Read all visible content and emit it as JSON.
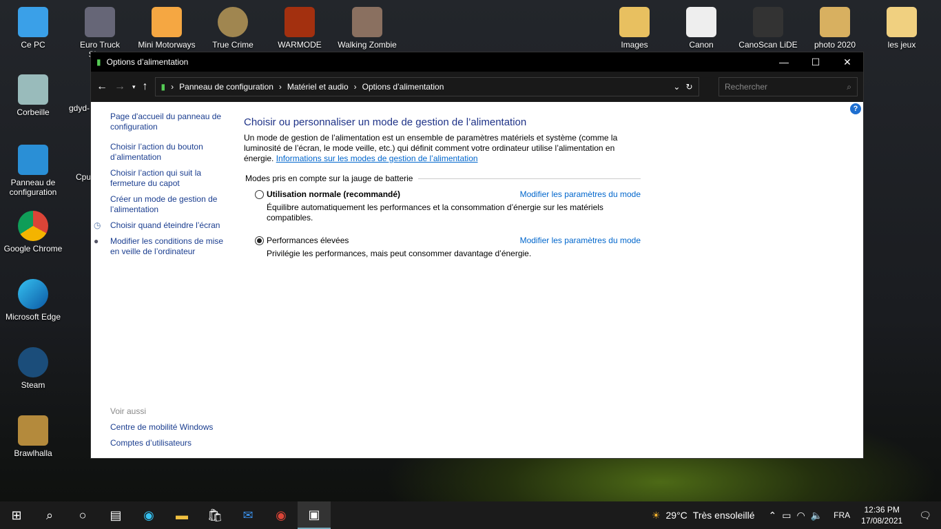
{
  "desktop": {
    "icons_top": [
      "Euro Truck Sim…",
      "Mini Motorways",
      "True Crime",
      "WARMODE",
      "Walking Zombie",
      "Images",
      "Canon",
      "CanoScan LiDE",
      "photo 2020",
      "les jeux"
    ],
    "icons_left": [
      "Ce PC",
      "Corbeille",
      "Panneau de configuration",
      "Google Chrome",
      "Microsoft Edge",
      "Steam",
      "Brawlhalla"
    ],
    "partial": [
      "gdyd-",
      "Cpu"
    ]
  },
  "window": {
    "title": "Options d’alimentation",
    "breadcrumb": [
      "Panneau de configuration",
      "Matériel et audio",
      "Options d’alimentation"
    ],
    "search_placeholder": "Rechercher",
    "sidebar": [
      "Page d'accueil du panneau de configuration",
      "Choisir l’action du bouton d’alimentation",
      "Choisir l’action qui suit la fermeture du capot",
      "Créer un mode de gestion de l’alimentation",
      "Choisir quand éteindre l’écran",
      "Modifier les conditions de mise en veille de l’ordinateur"
    ],
    "see_also": "Voir aussi",
    "see_also_links": [
      "Centre de mobilité Windows",
      "Comptes d’utilisateurs"
    ],
    "heading": "Choisir ou personnaliser un mode de gestion de l’alimentation",
    "intro": "Un mode de gestion de l’alimentation est un ensemble de paramètres matériels et système (comme la luminosité de l’écran, le mode veille, etc.) qui définit comment votre ordinateur utilise l’alimentation en énergie.",
    "intro_link": "Informations sur les modes de gestion de l’alimentation",
    "group": "Modes pris en compte sur la jauge de batterie",
    "plans": [
      {
        "name": "Utilisation normale (recommandé)",
        "selected": false,
        "desc": "Équilibre automatiquement les performances et la consommation d’énergie sur les matériels compatibles.",
        "link": "Modifier les paramètres du mode"
      },
      {
        "name": "Performances élevées",
        "selected": true,
        "desc": "Privilégie les performances, mais peut consommer davantage d’énergie.",
        "link": "Modifier les paramètres du mode"
      }
    ]
  },
  "taskbar": {
    "weather": "29°C",
    "weather_text": "Très ensoleillé",
    "lang": "FRA",
    "time": "12:36 PM",
    "date": "17/08/2021"
  }
}
